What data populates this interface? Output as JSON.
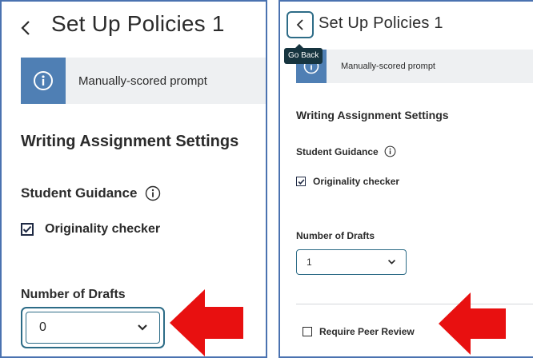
{
  "left": {
    "title": "Set Up Policies 1",
    "banner_text": "Manually-scored prompt",
    "section_title": "Writing Assignment Settings",
    "student_guidance": "Student Guidance",
    "originality_checker": "Originality checker",
    "number_of_drafts_label": "Number of Drafts",
    "drafts_value": "0"
  },
  "right": {
    "title": "Set Up Policies 1",
    "tooltip": "Go Back",
    "banner_text": "Manually-scored prompt",
    "section_title": "Writing Assignment Settings",
    "student_guidance": "Student Guidance",
    "originality_checker": "Originality checker",
    "number_of_drafts_label": "Number of Drafts",
    "drafts_value": "1",
    "require_peer_review": "Require Peer Review"
  },
  "icons": {
    "back": "chevron-left-icon",
    "info": "info-circle-icon",
    "dropdown": "chevron-down-icon",
    "annotation": "red-arrow-icon"
  },
  "colors": {
    "panel_border": "#4a72b0",
    "banner_accent": "#4f7fb4",
    "focus_ring": "#2d6c87",
    "tooltip_bg": "#16343f",
    "annotation_arrow": "#e81010"
  }
}
